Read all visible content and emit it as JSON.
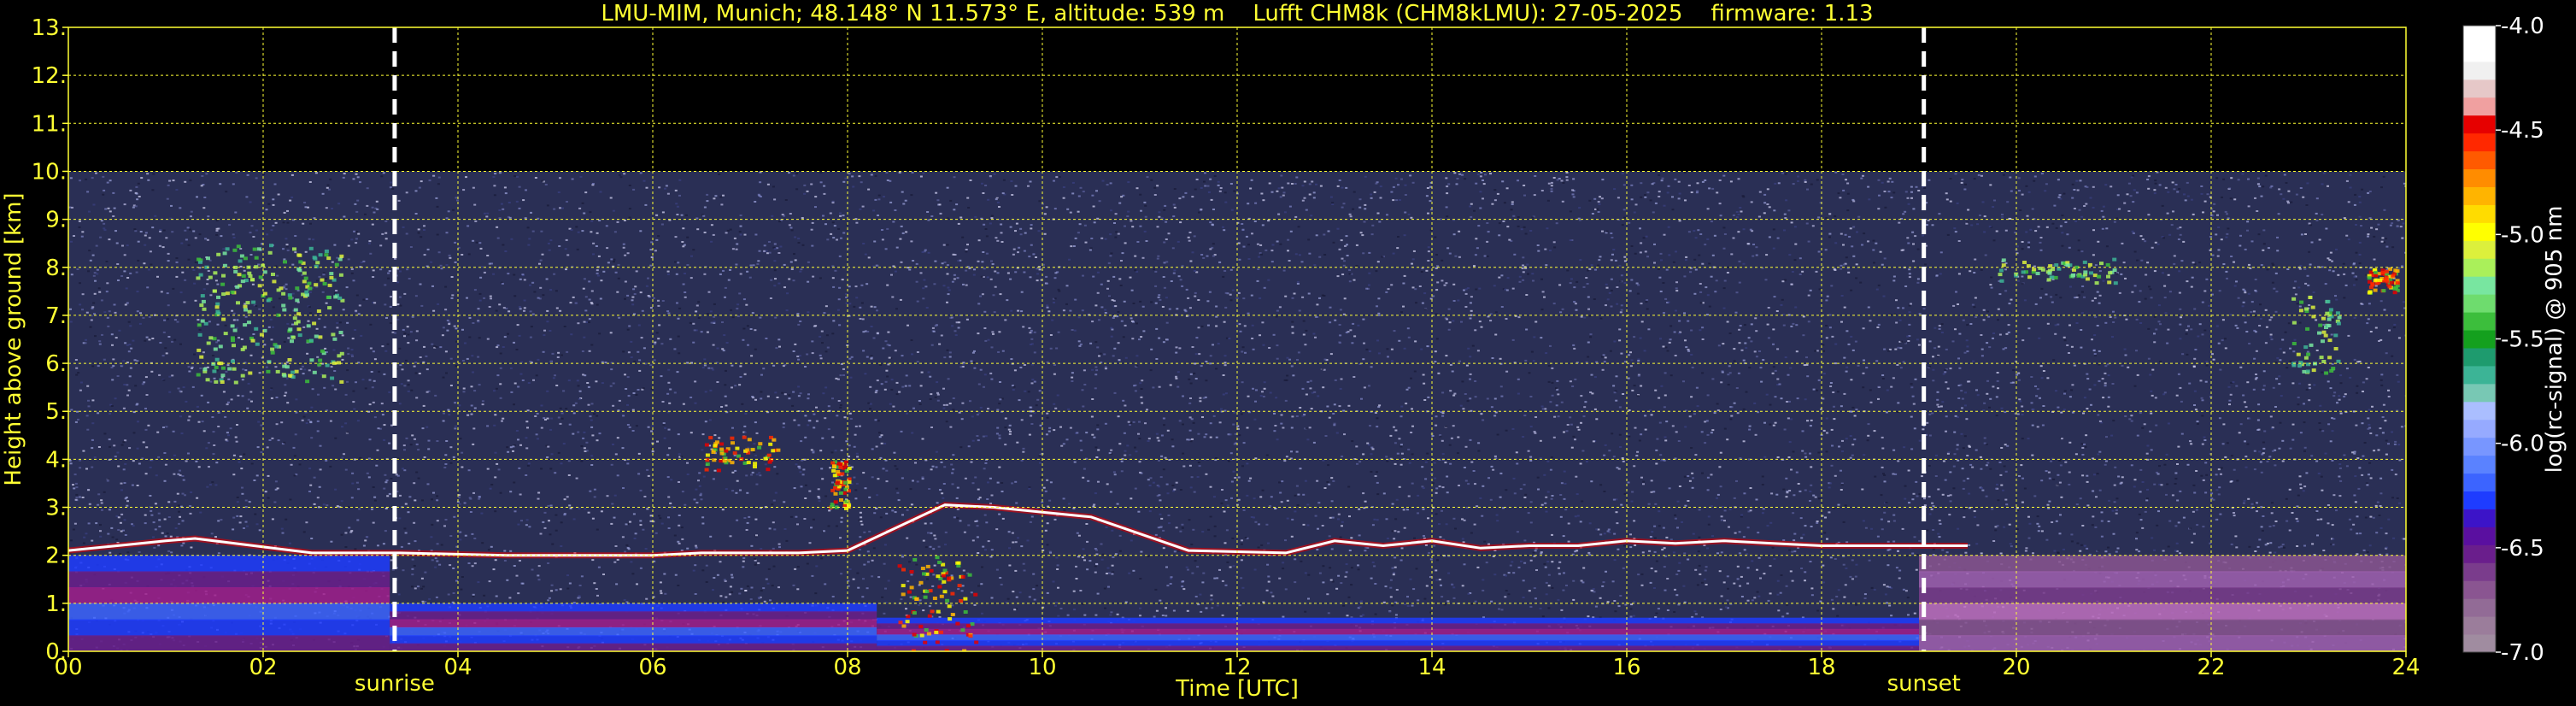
{
  "chart_data": {
    "type": "heatmap",
    "title": "LMU-MIM, Munich; 48.148° N 11.573° E, altitude: 539 m    Lufft CHM8k (CHM8kLMU): 27-05-2025    firmware: 1.13",
    "xlabel": "Time [UTC]",
    "ylabel": "Height above ground [km]",
    "xlim": [
      0,
      24
    ],
    "ylim": [
      0,
      13
    ],
    "x_ticks": [
      {
        "value": 0,
        "label": "00"
      },
      {
        "value": 2,
        "label": "02"
      },
      {
        "value": 4,
        "label": "04"
      },
      {
        "value": 6,
        "label": "06"
      },
      {
        "value": 8,
        "label": "08"
      },
      {
        "value": 10,
        "label": "10"
      },
      {
        "value": 12,
        "label": "12"
      },
      {
        "value": 14,
        "label": "14"
      },
      {
        "value": 16,
        "label": "16"
      },
      {
        "value": 18,
        "label": "18"
      },
      {
        "value": 20,
        "label": "20"
      },
      {
        "value": 22,
        "label": "22"
      },
      {
        "value": 24,
        "label": "24"
      }
    ],
    "y_ticks": [
      {
        "value": 0,
        "label": "0."
      },
      {
        "value": 1,
        "label": "1."
      },
      {
        "value": 2,
        "label": "2."
      },
      {
        "value": 3,
        "label": "3."
      },
      {
        "value": 4,
        "label": "4."
      },
      {
        "value": 5,
        "label": "5."
      },
      {
        "value": 6,
        "label": "6."
      },
      {
        "value": 7,
        "label": "7."
      },
      {
        "value": 8,
        "label": "8."
      },
      {
        "value": 9,
        "label": "9."
      },
      {
        "value": 10,
        "label": "10."
      },
      {
        "value": 11,
        "label": "11."
      },
      {
        "value": 12,
        "label": "12."
      },
      {
        "value": 13,
        "label": "13."
      }
    ],
    "grid": true,
    "markers": [
      {
        "label": "sunrise",
        "x": 3.35
      },
      {
        "label": "sunset",
        "x": 19.05
      }
    ],
    "data_top_km": 10,
    "colorbar": {
      "label": "log(rc-signal) @ 905 nm",
      "range": [
        -7.0,
        -4.0
      ],
      "ticks": [
        {
          "value": -4.0,
          "label": "-4.0"
        },
        {
          "value": -4.5,
          "label": "-4.5"
        },
        {
          "value": -5.0,
          "label": "-5.0"
        },
        {
          "value": -5.5,
          "label": "-5.5"
        },
        {
          "value": -6.0,
          "label": "-6.0"
        },
        {
          "value": -6.5,
          "label": "-6.5"
        },
        {
          "value": -7.0,
          "label": "-7.0"
        }
      ],
      "colors": [
        "#a08ca0",
        "#9b7d9b",
        "#926b96",
        "#8a5591",
        "#7a3c8c",
        "#6a1e8c",
        "#5a0fa0",
        "#3c14c8",
        "#1e3cff",
        "#3c64ff",
        "#5a82ff",
        "#7896ff",
        "#96aaff",
        "#aabeff",
        "#78c8b4",
        "#3cb496",
        "#1e9b6e",
        "#14a01e",
        "#3cbe3c",
        "#6edc6e",
        "#78e6a0",
        "#aaf05a",
        "#dcf03c",
        "#ffff00",
        "#ffdc00",
        "#ffb400",
        "#ff8c00",
        "#ff5a00",
        "#ff2800",
        "#e60000",
        "#f0a0a0",
        "#e6c8c8",
        "#f0f0f0",
        "#ffffff",
        "#ffffff"
      ]
    },
    "cloud_layer": [
      {
        "x": 0.0,
        "y": 2.1
      },
      {
        "x": 0.5,
        "y": 2.2
      },
      {
        "x": 1.0,
        "y": 2.3
      },
      {
        "x": 1.3,
        "y": 2.35
      },
      {
        "x": 2.5,
        "y": 2.05
      },
      {
        "x": 3.4,
        "y": 2.05
      },
      {
        "x": 4.5,
        "y": 2.0
      },
      {
        "x": 6.0,
        "y": 2.0
      },
      {
        "x": 6.5,
        "y": 2.05
      },
      {
        "x": 7.5,
        "y": 2.05
      },
      {
        "x": 8.0,
        "y": 2.1
      },
      {
        "x": 9.0,
        "y": 3.05
      },
      {
        "x": 9.5,
        "y": 3.0
      },
      {
        "x": 10.0,
        "y": 2.9
      },
      {
        "x": 10.5,
        "y": 2.8
      },
      {
        "x": 11.5,
        "y": 2.1
      },
      {
        "x": 12.5,
        "y": 2.05
      },
      {
        "x": 13.0,
        "y": 2.3
      },
      {
        "x": 13.5,
        "y": 2.2
      },
      {
        "x": 14.0,
        "y": 2.3
      },
      {
        "x": 14.5,
        "y": 2.15
      },
      {
        "x": 15.0,
        "y": 2.2
      },
      {
        "x": 15.5,
        "y": 2.2
      },
      {
        "x": 16.0,
        "y": 2.3
      },
      {
        "x": 16.5,
        "y": 2.25
      },
      {
        "x": 17.0,
        "y": 2.3
      },
      {
        "x": 17.5,
        "y": 2.25
      },
      {
        "x": 18.0,
        "y": 2.2
      },
      {
        "x": 18.5,
        "y": 2.2
      },
      {
        "x": 19.0,
        "y": 2.2
      },
      {
        "x": 19.5,
        "y": 2.2
      }
    ],
    "cloud_patches": [
      {
        "x": [
          1.3,
          2.8
        ],
        "y": [
          5.6,
          8.5
        ],
        "level": "high"
      },
      {
        "x": [
          6.5,
          7.3
        ],
        "y": [
          3.8,
          4.5
        ],
        "level": "very high"
      },
      {
        "x": [
          7.8,
          8.0
        ],
        "y": [
          3.0,
          4.0
        ],
        "level": "very high"
      },
      {
        "x": [
          8.5,
          9.3
        ],
        "y": [
          0.0,
          2.0
        ],
        "level": "very high"
      },
      {
        "x": [
          19.8,
          21.0
        ],
        "y": [
          7.7,
          8.2
        ],
        "level": "high"
      },
      {
        "x": [
          22.8,
          23.3
        ],
        "y": [
          5.8,
          7.5
        ],
        "level": "high"
      },
      {
        "x": [
          23.6,
          23.9
        ],
        "y": [
          7.5,
          8.0
        ],
        "level": "very high"
      }
    ],
    "boundary_layer": [
      {
        "x": [
          0,
          3.3
        ],
        "y": [
          0,
          2.0
        ],
        "level": "low"
      },
      {
        "x": [
          3.3,
          8.3
        ],
        "y": [
          0,
          1.0
        ],
        "level": "low"
      },
      {
        "x": [
          8.3,
          19.0
        ],
        "y": [
          0,
          0.7
        ],
        "level": "low"
      },
      {
        "x": [
          19.0,
          24
        ],
        "y": [
          0,
          2.0
        ],
        "level": "lowest"
      }
    ]
  }
}
